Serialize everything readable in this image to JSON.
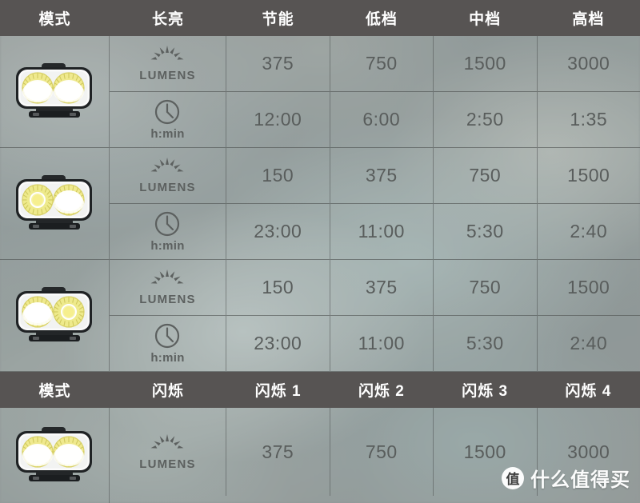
{
  "spec_table": {
    "headers_constant": {
      "columns": [
        "模式",
        "长亮",
        "节能",
        "低档",
        "中档",
        "高档"
      ]
    },
    "headers_flash": {
      "columns": [
        "模式",
        "闪烁",
        "闪烁 1",
        "闪烁 2",
        "闪烁 3",
        "闪烁 4"
      ]
    },
    "units": {
      "lumens_label": "LUMENS",
      "time_label": "h:min",
      "lumens_icon": "sun-icon",
      "time_icon": "clock-icon"
    },
    "groups": [
      {
        "lamp_state": "both-bright",
        "lumens": [
          "375",
          "750",
          "1500",
          "3000"
        ],
        "runtime": [
          "12:00",
          "6:00",
          "2:50",
          "1:35"
        ]
      },
      {
        "lamp_state": "left-dim-right-bright",
        "lumens": [
          "150",
          "375",
          "750",
          "1500"
        ],
        "runtime": [
          "23:00",
          "11:00",
          "5:30",
          "2:40"
        ]
      },
      {
        "lamp_state": "left-bright-right-dim",
        "lumens": [
          "150",
          "375",
          "750",
          "1500"
        ],
        "runtime": [
          "23:00",
          "11:00",
          "5:30",
          "2:40"
        ]
      }
    ],
    "flash_group": {
      "lamp_state": "both-bright",
      "lumens": [
        "375",
        "750",
        "1500",
        "3000"
      ]
    }
  },
  "watermark": {
    "badge": "值",
    "text": "什么值得买"
  },
  "colors": {
    "header_bg": "#575453",
    "header_text": "#ffffff",
    "value_text": "#595d5c",
    "grid_line": "#50544f",
    "led_warm": "#e8e06a",
    "led_hot": "#ffffff"
  }
}
